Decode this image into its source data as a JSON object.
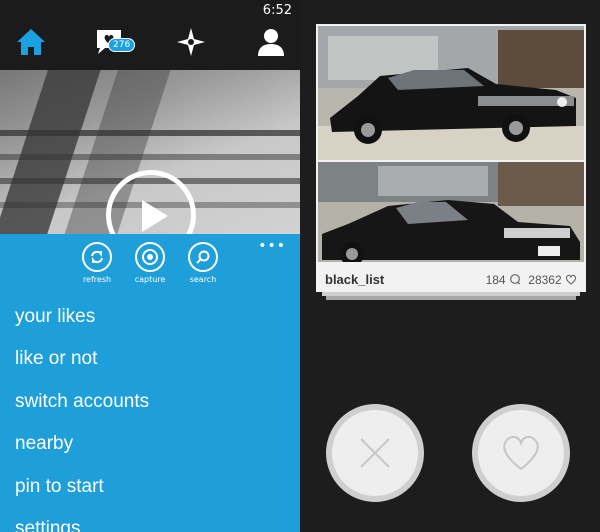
{
  "status": {
    "time": "6:52"
  },
  "nav": {
    "items": [
      {
        "icon": "home-icon",
        "color": "#1ba1e2"
      },
      {
        "icon": "chat-heart-icon"
      },
      {
        "icon": "explore-star-icon"
      },
      {
        "icon": "profile-icon"
      }
    ],
    "notifications_badge": "276"
  },
  "video": {
    "state": "paused"
  },
  "actions": {
    "more": "•••",
    "refresh_label": "refresh",
    "capture_label": "capture",
    "search_label": "search"
  },
  "menu": {
    "items": [
      "your likes",
      "like or not",
      "switch accounts",
      "nearby",
      "pin to start",
      "settings"
    ]
  },
  "post": {
    "username": "black_list",
    "comments_count": "184",
    "likes_count": "28362"
  },
  "colors": {
    "accent": "#1e9fd9",
    "background": "#1d1d1d"
  }
}
